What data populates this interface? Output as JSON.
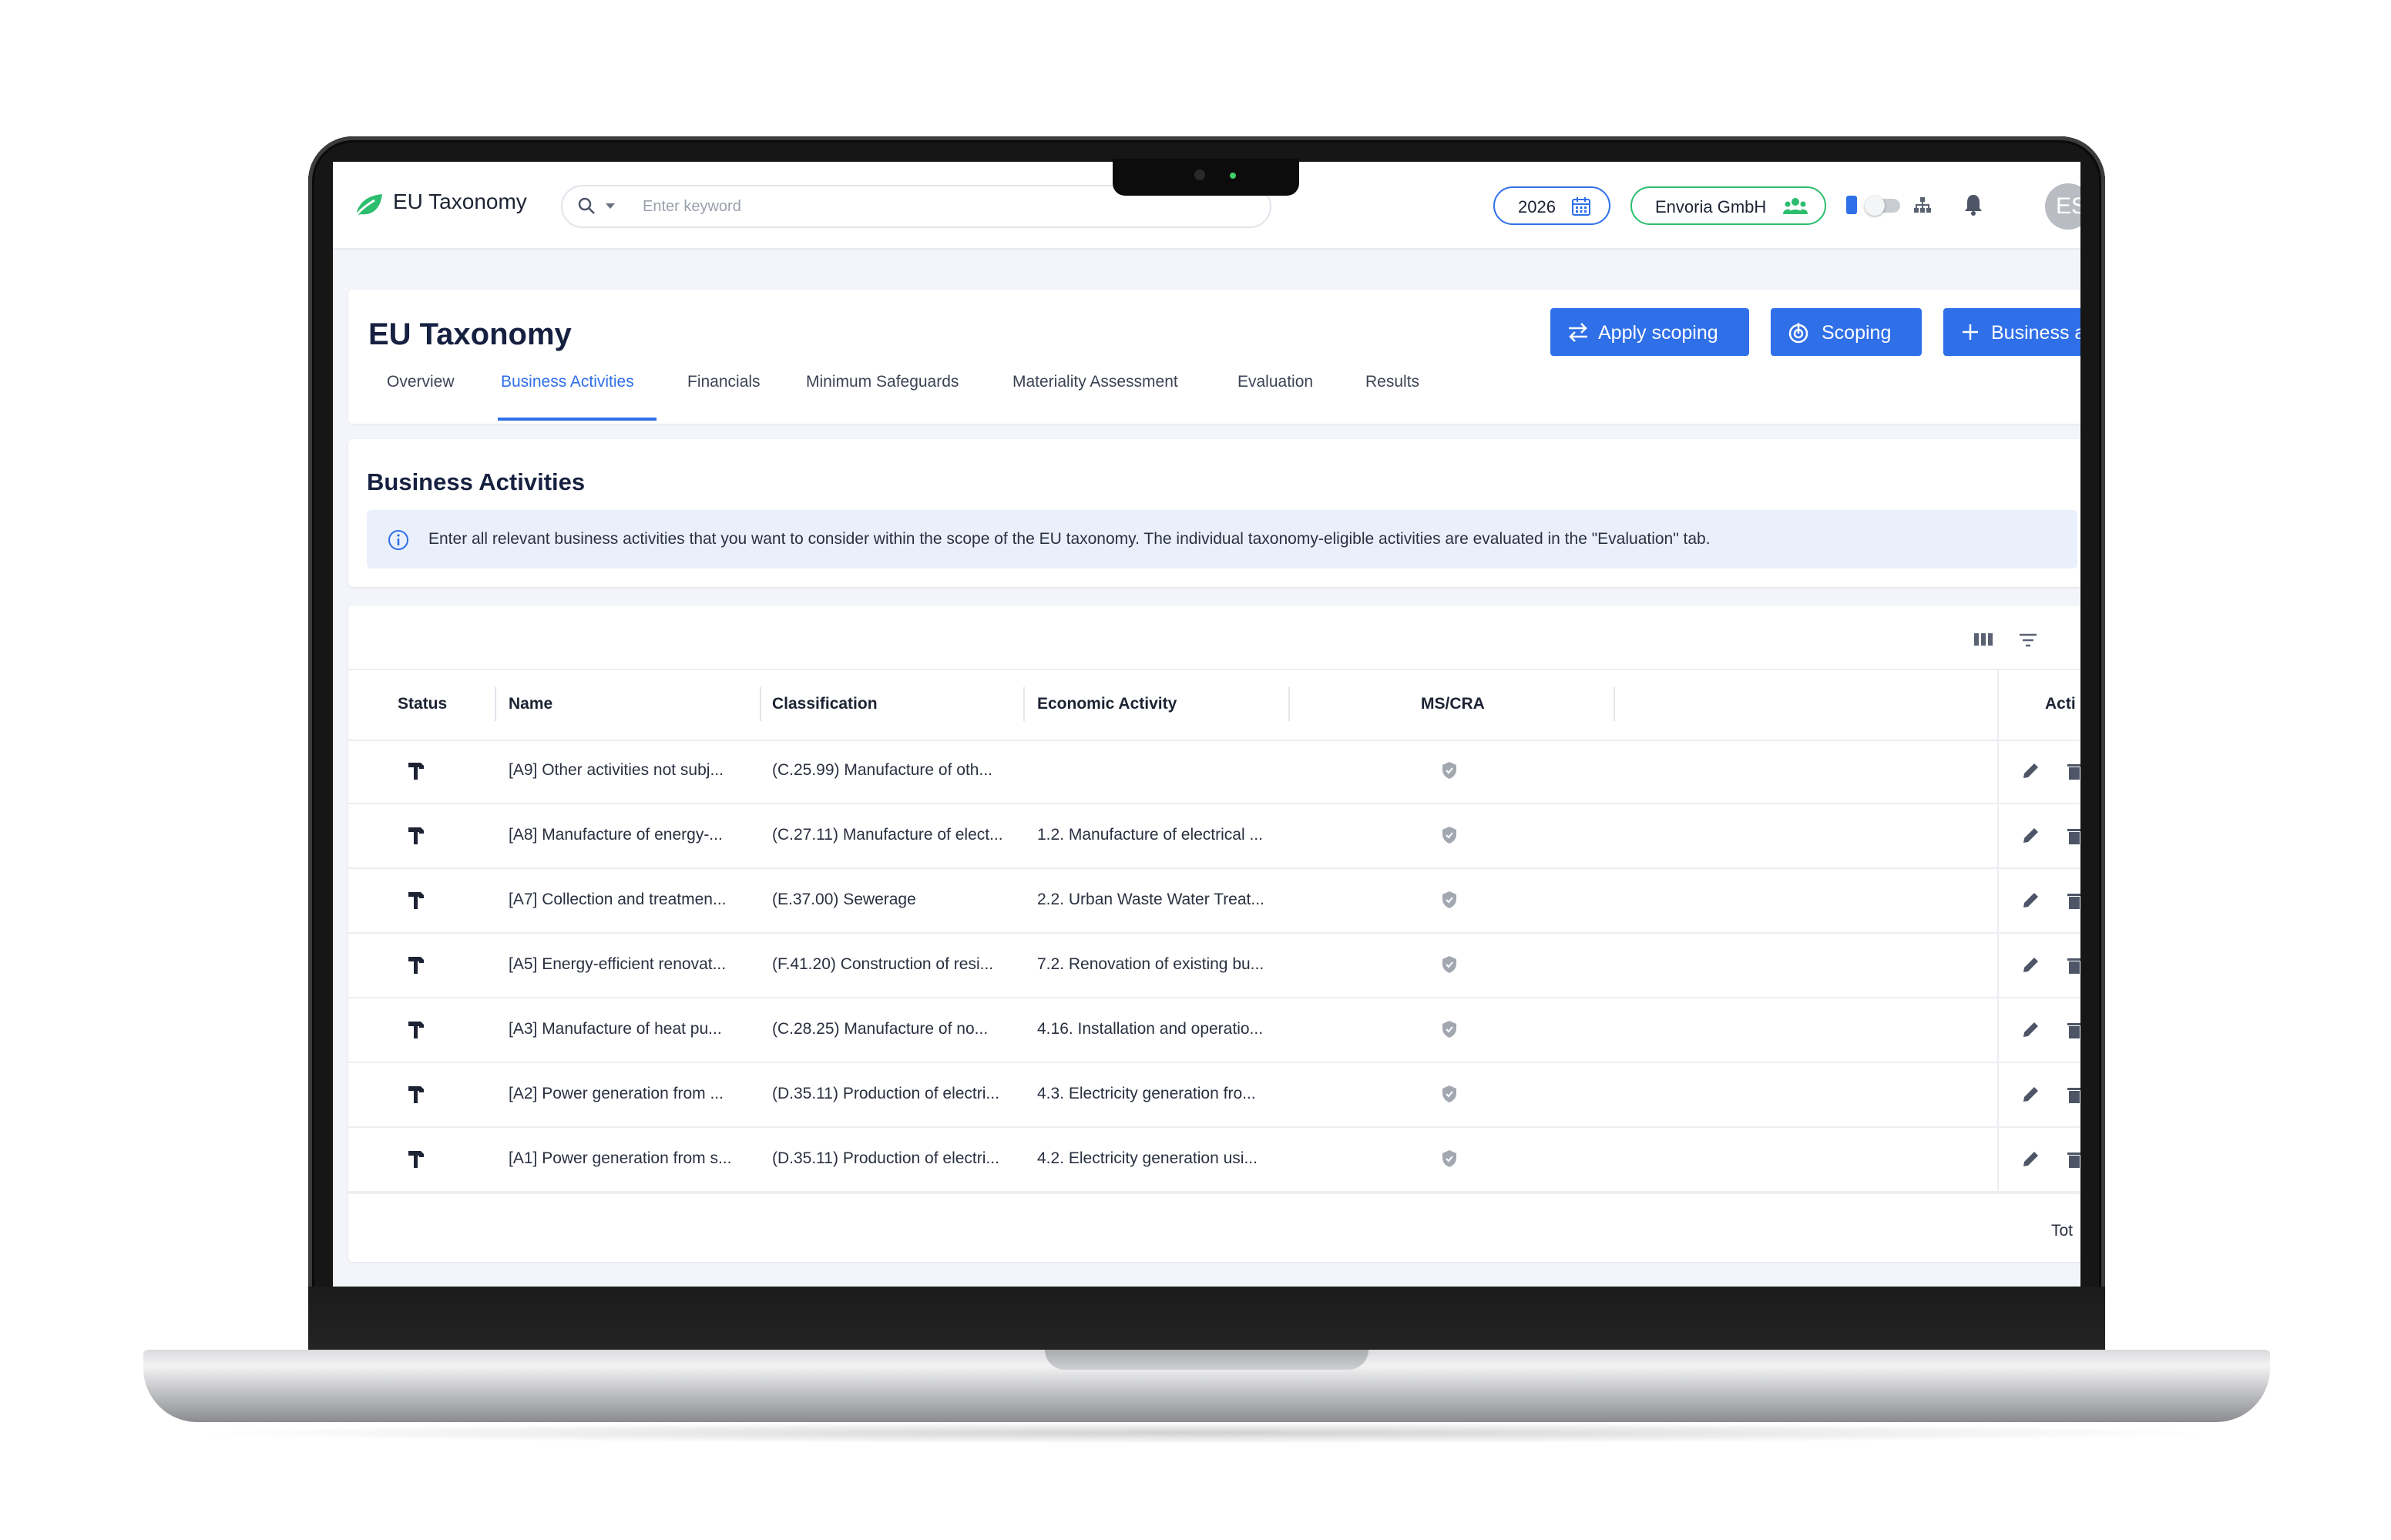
{
  "app": {
    "title": "EU Taxonomy"
  },
  "search": {
    "placeholder": "Enter keyword",
    "value": ""
  },
  "topbar": {
    "year": "2026",
    "company": "Envoria GmbH",
    "user_initials": "ES"
  },
  "page": {
    "title": "EU Taxonomy",
    "buttons": {
      "apply_scoping": "Apply scoping",
      "scoping": "Scoping",
      "add_business": "Business a"
    },
    "tabs": [
      {
        "label": "Overview"
      },
      {
        "label": "Business Activities"
      },
      {
        "label": "Financials"
      },
      {
        "label": "Minimum Safeguards"
      },
      {
        "label": "Materiality Assessment"
      },
      {
        "label": "Evaluation"
      },
      {
        "label": "Results"
      }
    ],
    "active_tab": "Business Activities"
  },
  "section": {
    "title": "Business Activities",
    "info": "Enter all relevant business activities that you want to consider within the scope of the EU taxonomy. The individual taxonomy-eligible activities are evaluated in the \"Evaluation\" tab."
  },
  "table": {
    "columns": [
      "Status",
      "Name",
      "Classification",
      "Economic Activity",
      "MS/CRA",
      "Acti"
    ],
    "rows": [
      {
        "name": "[A9] Other activities not subj...",
        "classification": "(C.25.99) Manufacture of oth...",
        "economic_activity": ""
      },
      {
        "name": "[A8] Manufacture of energy-...",
        "classification": "(C.27.11) Manufacture of elect...",
        "economic_activity": "1.2. Manufacture of electrical ..."
      },
      {
        "name": "[A7] Collection and treatmen...",
        "classification": "(E.37.00) Sewerage",
        "economic_activity": "2.2. Urban Waste Water Treat..."
      },
      {
        "name": "[A5] Energy-efficient renovat...",
        "classification": "(F.41.20) Construction of resi...",
        "economic_activity": "7.2. Renovation of existing bu..."
      },
      {
        "name": "[A3] Manufacture of heat pu...",
        "classification": "(C.28.25) Manufacture of no...",
        "economic_activity": "4.16. Installation and operatio..."
      },
      {
        "name": "[A2] Power generation from ...",
        "classification": "(D.35.11) Production of electri...",
        "economic_activity": "4.3. Electricity generation fro..."
      },
      {
        "name": "[A1] Power generation from s...",
        "classification": "(D.35.11) Production of electri...",
        "economic_activity": "4.2. Electricity generation usi..."
      }
    ],
    "footer_total": "Tot"
  },
  "icons": {
    "logo": "leaf-icon",
    "search": "search-icon",
    "calendar": "calendar-icon",
    "company": "users-icon",
    "notification": "bell-icon",
    "hierarchy": "sitemap-icon",
    "columns": "columns-icon",
    "filter": "filter-icon",
    "status": "hammer-icon",
    "ms_cra": "shield-icon",
    "edit": "pencil-icon",
    "delete": "trash-icon"
  },
  "colors": {
    "primary": "#2f6fe8",
    "brand_green": "#2dbd6e",
    "title": "#162040"
  }
}
